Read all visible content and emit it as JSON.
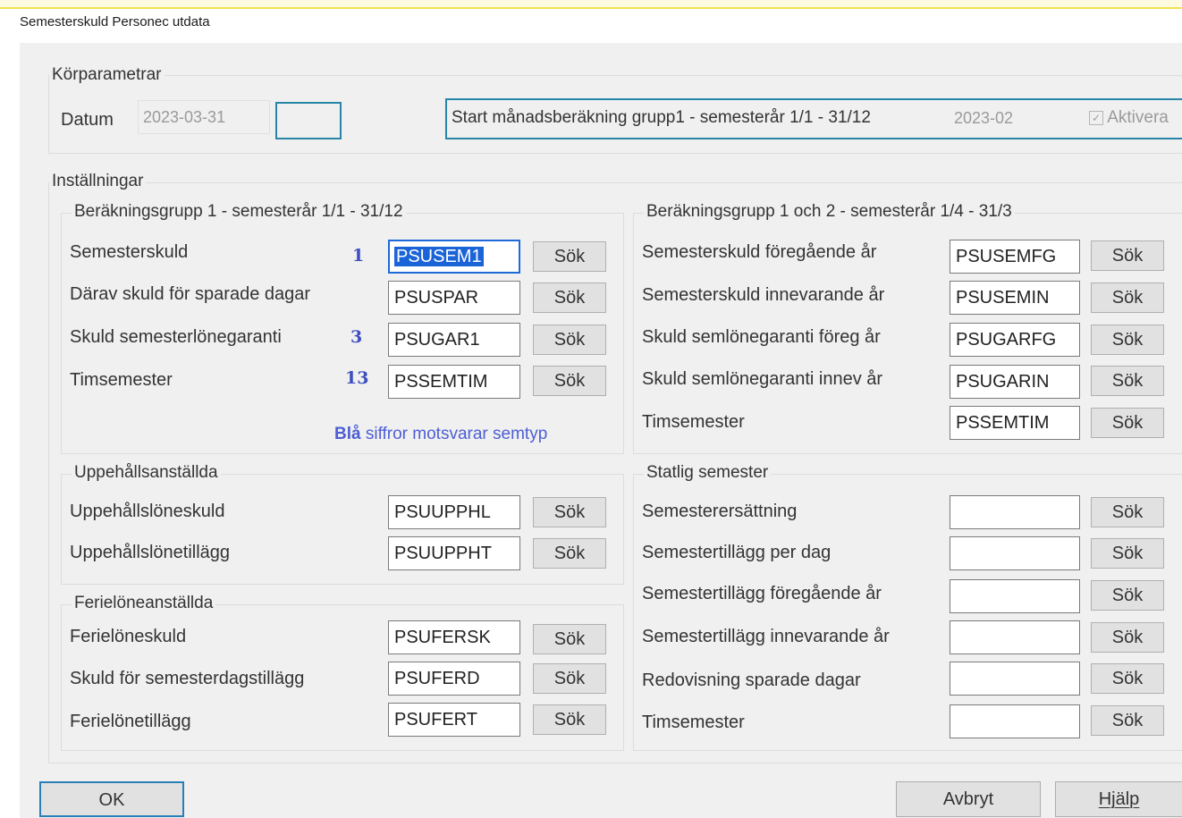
{
  "window": {
    "title": "Semesterskuld Personec utdata"
  },
  "korparametrar": {
    "label": "Körparametrar",
    "datum_label": "Datum",
    "datum_value": "2023-03-31",
    "start_label": "Start månadsberäkning grupp1 - semesterår 1/1 - 31/12",
    "start_value": "2023-02",
    "aktivera_label": "Aktivera",
    "aktivera_checked": true
  },
  "installningar": {
    "label": "Inställningar",
    "grupp1": {
      "label": "Beräkningsgrupp 1 - semesterår 1/1 - 31/12",
      "rows": [
        {
          "label": "Semesterskuld",
          "num": "1",
          "value": "PSUSEM1",
          "button": "Sök"
        },
        {
          "label": "Därav skuld för sparade dagar",
          "num": "",
          "value": "PSUSPAR",
          "button": "Sök"
        },
        {
          "label": "Skuld semesterlönegaranti",
          "num": "3",
          "value": "PSUGAR1",
          "button": "Sök"
        },
        {
          "label": "Timsemester",
          "num": "13",
          "value": "PSSEMTIM",
          "button": "Sök"
        }
      ],
      "note_bold": "Blå",
      "note_rest": " siffror motsvarar semtyp"
    },
    "grupp12": {
      "label": "Beräkningsgrupp 1 och 2 - semesterår 1/4 - 31/3",
      "rows": [
        {
          "label": "Semesterskuld föregående år",
          "value": "PSUSEMFG",
          "button": "Sök"
        },
        {
          "label": "Semesterskuld innevarande år",
          "value": "PSUSEMIN",
          "button": "Sök"
        },
        {
          "label": "Skuld semlönegaranti föreg år",
          "value": "PSUGARFG",
          "button": "Sök"
        },
        {
          "label": "Skuld semlönegaranti innev år",
          "value": "PSUGARIN",
          "button": "Sök"
        },
        {
          "label": "Timsemester",
          "value": "PSSEMTIM",
          "button": "Sök"
        }
      ]
    },
    "uppehall": {
      "label": "Uppehållsanställda",
      "rows": [
        {
          "label": "Uppehållslöneskuld",
          "value": "PSUUPPHL",
          "button": "Sök"
        },
        {
          "label": "Uppehållslönetillägg",
          "value": "PSUUPPHT",
          "button": "Sök"
        }
      ]
    },
    "ferie": {
      "label": "Ferielöneanställda",
      "rows": [
        {
          "label": "Ferielöneskuld",
          "value": "PSUFERSK",
          "button": "Sök"
        },
        {
          "label": "Skuld för semesterdagstillägg",
          "value": "PSUFERD",
          "button": "Sök"
        },
        {
          "label": "Ferielönetillägg",
          "value": "PSUFERT",
          "button": "Sök"
        }
      ]
    },
    "statlig": {
      "label": "Statlig semester",
      "rows": [
        {
          "label": "Semesterersättning",
          "value": "",
          "button": "Sök"
        },
        {
          "label": "Semestertillägg per dag",
          "value": "",
          "button": "Sök"
        },
        {
          "label": "Semestertillägg föregående år",
          "value": "",
          "button": "Sök"
        },
        {
          "label": "Semestertillägg innevarande år",
          "value": "",
          "button": "Sök"
        },
        {
          "label": "Redovisning sparade dagar",
          "value": "",
          "button": "Sök"
        },
        {
          "label": "Timsemester",
          "value": "",
          "button": "Sök"
        }
      ]
    }
  },
  "footer": {
    "ok": "OK",
    "avbryt": "Avbryt",
    "hjalp": "Hjälp"
  }
}
